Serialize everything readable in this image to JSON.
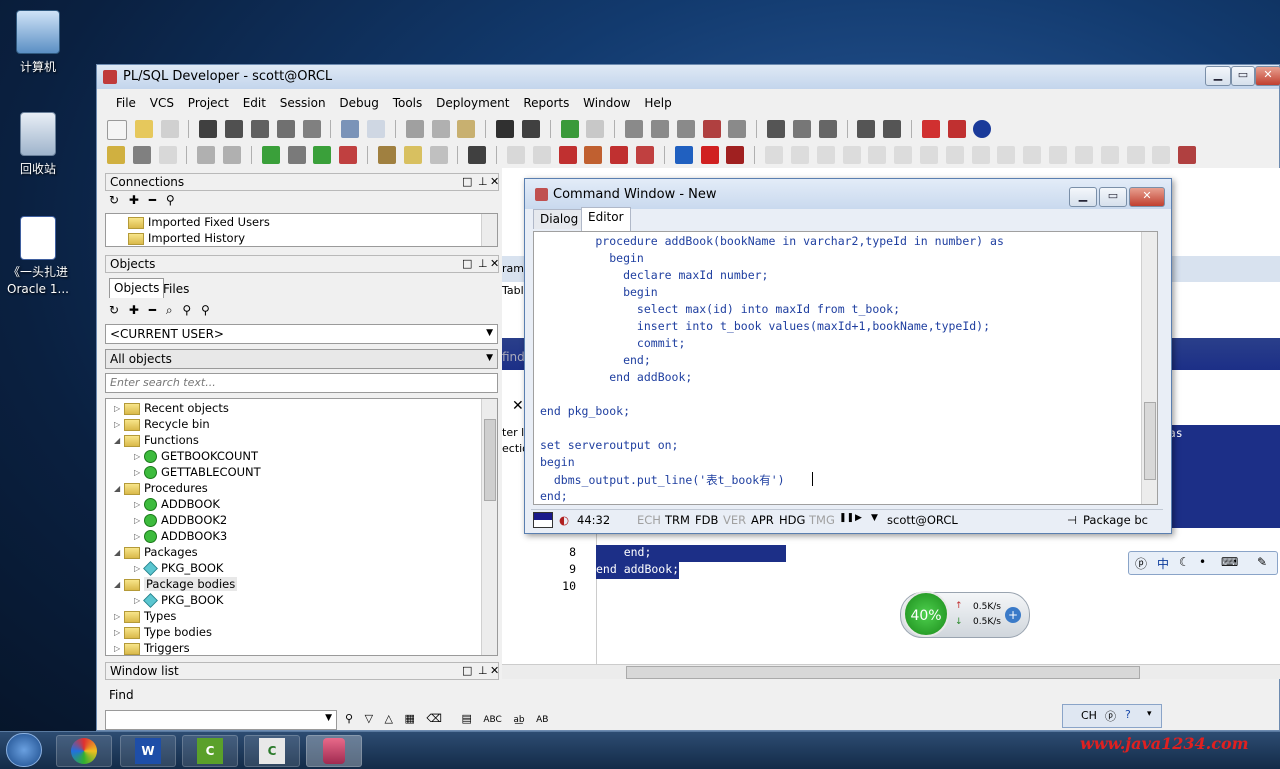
{
  "desktop": {
    "icons": [
      {
        "label": "计算机"
      },
      {
        "label": "回收站"
      },
      {
        "label": "《一头扎进Oracle 1..."
      }
    ]
  },
  "main_window": {
    "title": "PL/SQL Developer - scott@ORCL",
    "menu": [
      "File",
      "VCS",
      "Project",
      "Edit",
      "Session",
      "Debug",
      "Tools",
      "Deployment",
      "Reports",
      "Window",
      "Help"
    ]
  },
  "connections": {
    "header": "Connections",
    "items": [
      "Imported Fixed Users",
      "Imported History"
    ]
  },
  "objects": {
    "header": "Objects",
    "tabs": [
      "Objects",
      "Files"
    ],
    "user_select": "<CURRENT USER>",
    "filter_select": "All objects",
    "search_placeholder": "Enter search text...",
    "tree": [
      {
        "label": "Recent objects",
        "kind": "folder",
        "level": 0,
        "expanded": false
      },
      {
        "label": "Recycle bin",
        "kind": "folder",
        "level": 0,
        "expanded": false
      },
      {
        "label": "Functions",
        "kind": "folder",
        "level": 0,
        "expanded": true
      },
      {
        "label": "GETBOOKCOUNT",
        "kind": "proc",
        "level": 1,
        "expanded": false
      },
      {
        "label": "GETTABLECOUNT",
        "kind": "proc",
        "level": 1,
        "expanded": false
      },
      {
        "label": "Procedures",
        "kind": "folder",
        "level": 0,
        "expanded": true
      },
      {
        "label": "ADDBOOK",
        "kind": "proc",
        "level": 1,
        "expanded": false
      },
      {
        "label": "ADDBOOK2",
        "kind": "proc",
        "level": 1,
        "expanded": false
      },
      {
        "label": "ADDBOOK3",
        "kind": "proc",
        "level": 1,
        "expanded": false
      },
      {
        "label": "Packages",
        "kind": "folder",
        "level": 0,
        "expanded": true
      },
      {
        "label": "PKG_BOOK",
        "kind": "pkg",
        "level": 1,
        "expanded": false
      },
      {
        "label": "Package bodies",
        "kind": "folder",
        "level": 0,
        "expanded": true
      },
      {
        "label": "PKG_BOOK",
        "kind": "pkg",
        "level": 1,
        "expanded": false
      },
      {
        "label": "Types",
        "kind": "folder",
        "level": 0,
        "expanded": false
      },
      {
        "label": "Type bodies",
        "kind": "folder",
        "level": 0,
        "expanded": false
      },
      {
        "label": "Triggers",
        "kind": "folder",
        "level": 0,
        "expanded": false
      }
    ]
  },
  "window_list": {
    "header": "Window list"
  },
  "find": {
    "header": "Find",
    "opts": [
      "ABC",
      "AB"
    ]
  },
  "command_window": {
    "title": "Command Window - New",
    "tabs": [
      "Dialog",
      "Editor"
    ],
    "code_lines": [
      "        procedure addBook(bookName in varchar2,typeId in number) as",
      "          begin",
      "            declare maxId number;",
      "            begin",
      "              select max(id) into maxId from t_book;",
      "              insert into t_book values(maxId+1,bookName,typeId);",
      "              commit;",
      "            end;",
      "          end addBook;",
      "",
      "end pkg_book;",
      "",
      "set serveroutput on;",
      "begin",
      "  dbms_output.put_line('表t_book有')",
      "end;"
    ],
    "status": {
      "position": "44:32",
      "flags": [
        "ECH",
        "TRM",
        "FDB",
        "VER",
        "APR",
        "HDG",
        "TMG"
      ],
      "flags_active": [
        false,
        true,
        true,
        false,
        true,
        true,
        false
      ],
      "connection": "scott@ORCL",
      "object": "Package bc"
    }
  },
  "background_editor": {
    "line_numbers": [
      "8",
      "9",
      "10"
    ],
    "lines": [
      "    end;",
      "end addBook;",
      ""
    ],
    "right_fragment": "r) as",
    "left_fragments": [
      "ram",
      "Table",
      "find",
      "ter li",
      "ectio"
    ]
  },
  "netmeter": {
    "percent": "40%",
    "up": "0.5K/s",
    "down": "0.5K/s"
  },
  "ime": {
    "lang": "中",
    "label2": "CH"
  },
  "watermark": "www.java1234.com"
}
